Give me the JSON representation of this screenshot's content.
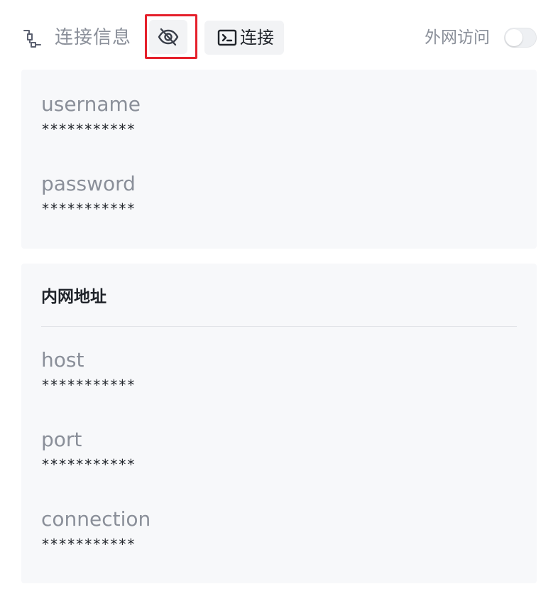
{
  "header": {
    "title": "连接信息",
    "connection_icon": "connection-plug-icon",
    "visibility_icon": "eye-off-icon",
    "connect_button": {
      "icon": "terminal-icon",
      "label": "连接"
    },
    "external_access": {
      "label": "外网访问",
      "enabled": false
    }
  },
  "credentials": {
    "fields": [
      {
        "name": "username",
        "value": "***********"
      },
      {
        "name": "password",
        "value": "***********"
      }
    ]
  },
  "intranet": {
    "title": "内网地址",
    "fields": [
      {
        "name": "host",
        "value": "***********"
      },
      {
        "name": "port",
        "value": "***********"
      },
      {
        "name": "connection",
        "value": "***********"
      }
    ]
  },
  "colors": {
    "highlight": "#e5202b",
    "card_background": "#f7f8fa",
    "muted_text": "#8a8f99"
  }
}
